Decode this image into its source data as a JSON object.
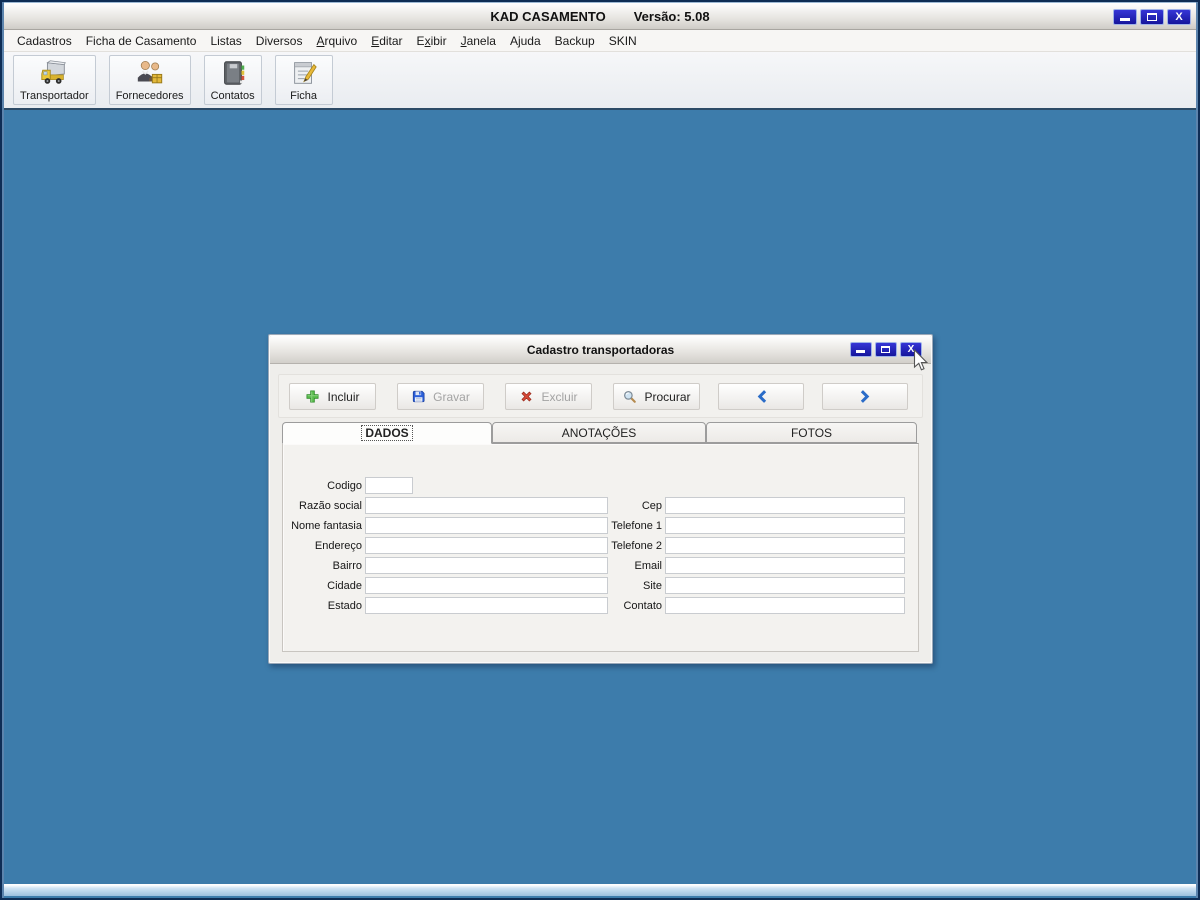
{
  "window": {
    "title": "KAD CASAMENTO",
    "version_label": "Versão: 5.08",
    "controls": [
      {
        "name": "minimize",
        "icon": "minimize-icon"
      },
      {
        "name": "maximize",
        "icon": "maximize-icon"
      },
      {
        "name": "close",
        "icon": "close-icon"
      }
    ]
  },
  "menu": {
    "items": [
      {
        "label": "Cadastros",
        "underline": -1
      },
      {
        "label": "Ficha de Casamento",
        "underline": -1
      },
      {
        "label": "Listas",
        "underline": -1
      },
      {
        "label": "Diversos",
        "underline": -1
      },
      {
        "label": "Arquivo",
        "underline": 0
      },
      {
        "label": "Editar",
        "underline": 0
      },
      {
        "label": "Exibir",
        "underline": 1
      },
      {
        "label": "Janela",
        "underline": 0
      },
      {
        "label": "Ajuda",
        "underline": -1
      },
      {
        "label": "Backup",
        "underline": -1
      },
      {
        "label": "SKIN",
        "underline": -1
      }
    ]
  },
  "toolbar": {
    "buttons": [
      {
        "label": "Transportador",
        "icon": "truck-icon"
      },
      {
        "label": "Fornecedores",
        "icon": "suppliers-icon"
      },
      {
        "label": "Contatos",
        "icon": "address-book-icon"
      },
      {
        "label": "Ficha",
        "icon": "note-icon"
      }
    ]
  },
  "dialog": {
    "title": "Cadastro transportadoras",
    "controls": [
      {
        "name": "minimize",
        "icon": "minimize-icon"
      },
      {
        "name": "maximize",
        "icon": "maximize-icon"
      },
      {
        "name": "close",
        "icon": "close-icon"
      }
    ],
    "buttons": [
      {
        "label": "Incluir",
        "icon": "plus-icon",
        "enabled": true
      },
      {
        "label": "Gravar",
        "icon": "save-icon",
        "enabled": false
      },
      {
        "label": "Excluir",
        "icon": "delete-icon",
        "enabled": false
      },
      {
        "label": "Procurar",
        "icon": "search-icon",
        "enabled": true
      },
      {
        "label": "",
        "icon": "arrow-left-icon",
        "enabled": true
      },
      {
        "label": "",
        "icon": "arrow-right-icon",
        "enabled": true
      }
    ],
    "tabs": [
      {
        "label": "DADOS",
        "active": true
      },
      {
        "label": "ANOTAÇÕES",
        "active": false
      },
      {
        "label": "FOTOS",
        "active": false
      }
    ],
    "form": {
      "left": [
        {
          "label": "Codigo",
          "value": "",
          "small": true
        },
        {
          "label": "Razão social",
          "value": ""
        },
        {
          "label": "Nome fantasia",
          "value": ""
        },
        {
          "label": "Endereço",
          "value": ""
        },
        {
          "label": "Bairro",
          "value": ""
        },
        {
          "label": "Cidade",
          "value": ""
        },
        {
          "label": "Estado",
          "value": ""
        }
      ],
      "right": [
        {
          "label": "Cep",
          "value": ""
        },
        {
          "label": "Telefone 1",
          "value": ""
        },
        {
          "label": "Telefone 2",
          "value": ""
        },
        {
          "label": "Email",
          "value": ""
        },
        {
          "label": "Site",
          "value": ""
        },
        {
          "label": "Contato",
          "value": ""
        }
      ]
    }
  },
  "colors": {
    "mdi_background": "#3D7CAB",
    "control_button_blue": "#1A1FB5",
    "chevron_blue": "#2B6CC8",
    "plus_green": "#55B948",
    "delete_red": "#D84A38",
    "save_blue": "#2B5FD9"
  }
}
